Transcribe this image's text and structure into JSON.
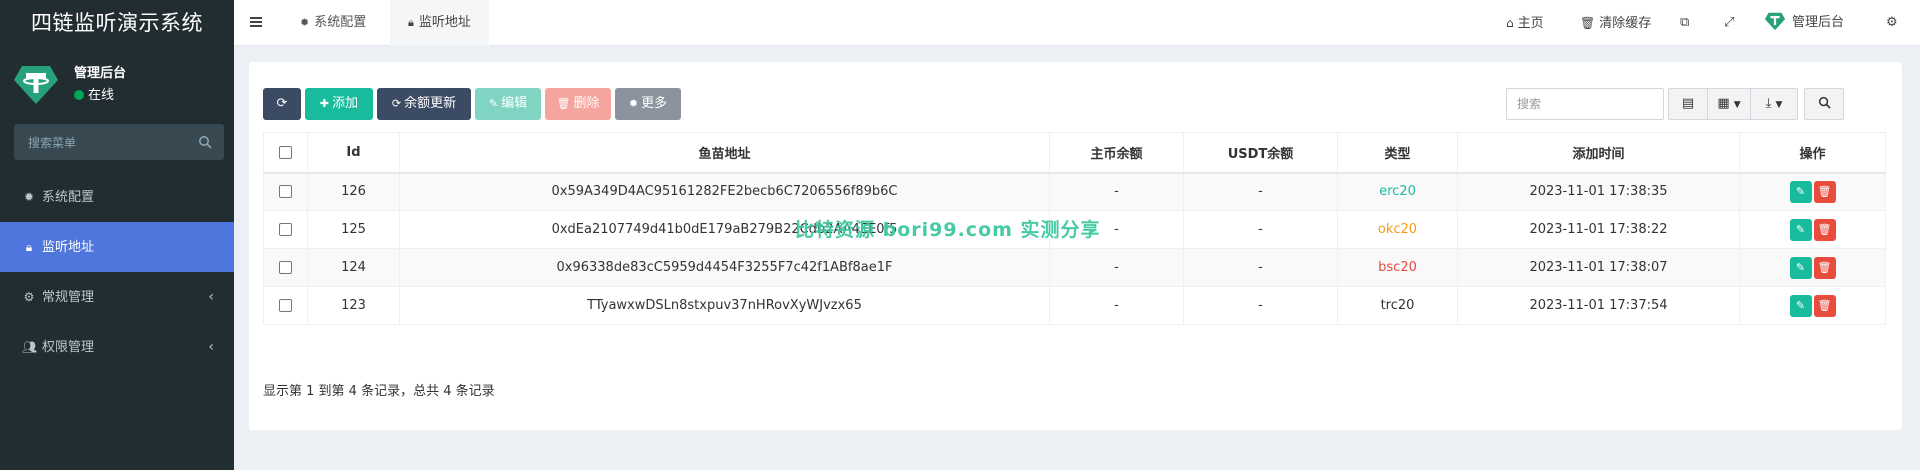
{
  "app": {
    "title": "四链监听演示系统"
  },
  "user": {
    "name": "管理后台",
    "status": "在线"
  },
  "sidebar": {
    "search_placeholder": "搜索菜单",
    "items": [
      {
        "icon": "gear-icon",
        "label": "系统配置"
      },
      {
        "icon": "lock-icon",
        "label": "监听地址",
        "active": true
      },
      {
        "icon": "gears-icon",
        "label": "常规管理",
        "has_children": true
      },
      {
        "icon": "users-icon",
        "label": "权限管理",
        "has_children": true
      }
    ]
  },
  "navbar": {
    "tabs": [
      {
        "icon": "gear-icon",
        "label": "系统配置"
      },
      {
        "icon": "lock-icon",
        "label": "监听地址",
        "active": true
      }
    ],
    "right": {
      "home": "主页",
      "clear_cache": "清除缓存",
      "admin": "管理后台"
    }
  },
  "toolbar": {
    "refresh": "",
    "add": "添加",
    "update_balance": "余额更新",
    "edit": "编辑",
    "delete": "删除",
    "more": "更多",
    "search_placeholder": "搜索"
  },
  "table": {
    "columns": [
      "Id",
      "鱼苗地址",
      "主币余额",
      "USDT余额",
      "类型",
      "添加时间",
      "操作"
    ],
    "rows": [
      {
        "id": "126",
        "address": "0x59A349D4AC95161282FE2becb6C7206556f89b6C",
        "main_balance": "-",
        "usdt_balance": "-",
        "type": "erc20",
        "type_color": "#18bc9c",
        "time": "2023-11-01 17:38:35"
      },
      {
        "id": "125",
        "address": "0xdEa2107749d41b0dE179aB279B22Cdb2AA4EE0f5",
        "main_balance": "-",
        "usdt_balance": "-",
        "type": "okc20",
        "type_color": "#f39c12",
        "time": "2023-11-01 17:38:22"
      },
      {
        "id": "124",
        "address": "0x96338de83cC5959d4454F3255F7c42f1ABf8ae1F",
        "main_balance": "-",
        "usdt_balance": "-",
        "type": "bsc20",
        "type_color": "#e74c3c",
        "time": "2023-11-01 17:38:07"
      },
      {
        "id": "123",
        "address": "TTyawxwDSLn8stxpuv37nHRovXyWJvzx65",
        "main_balance": "-",
        "usdt_balance": "-",
        "type": "trc20",
        "type_color": "#333333",
        "time": "2023-11-01 17:37:54"
      }
    ]
  },
  "pagination": {
    "summary": "显示第 1 到第 4 条记录，总共 4 条记录"
  },
  "watermark": "比特资源 bori99.com 实测分享"
}
